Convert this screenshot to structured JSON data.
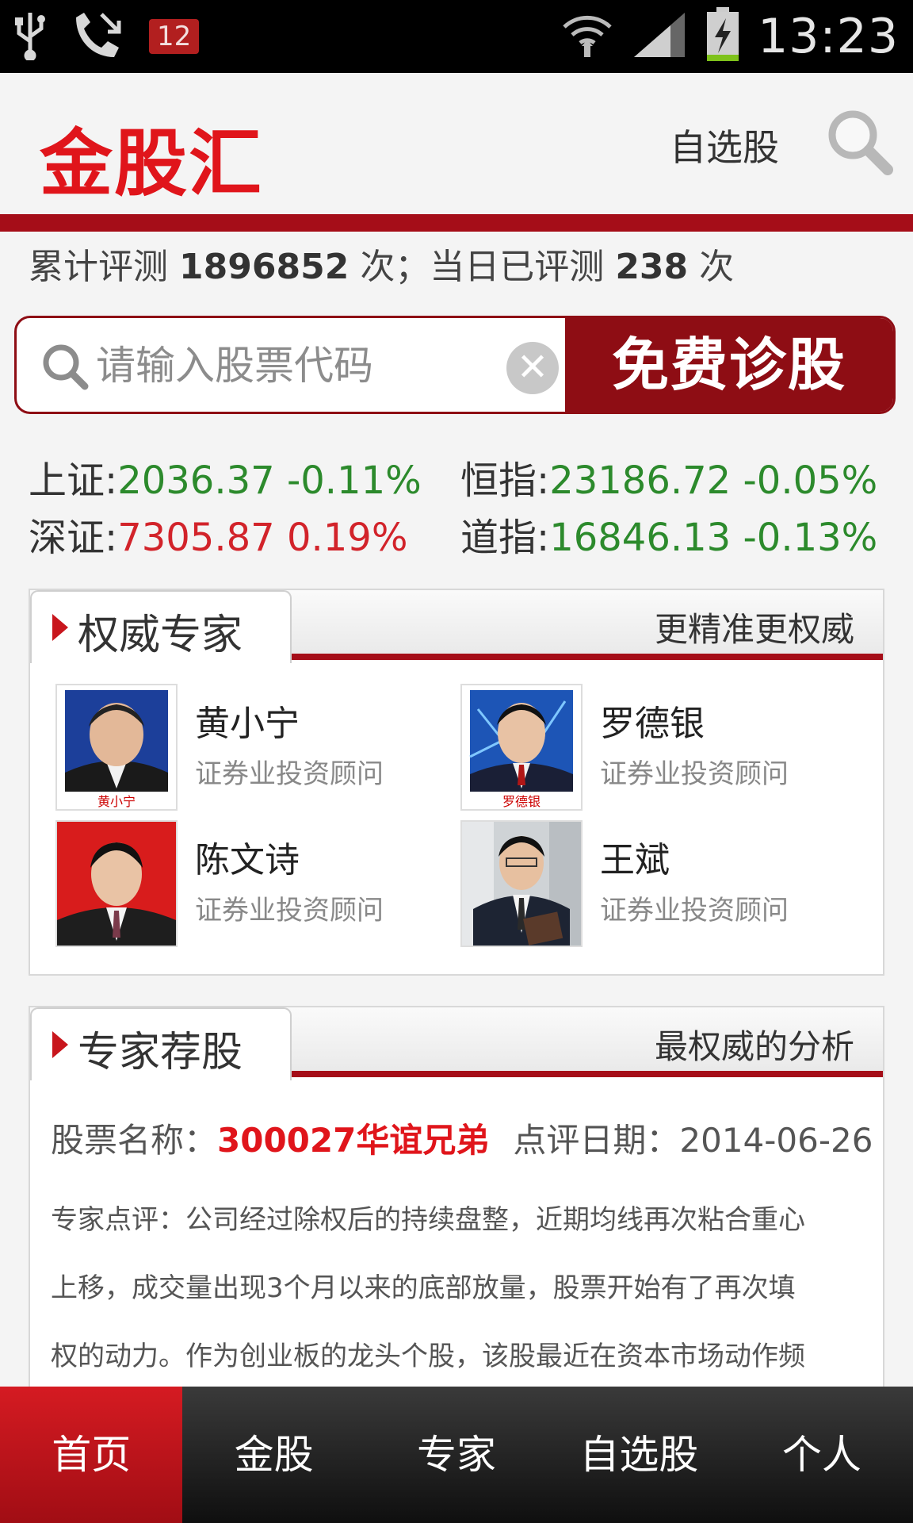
{
  "status_bar": {
    "notification_count": "12",
    "time": "13:23"
  },
  "header": {
    "logo": "金股汇",
    "watchlist_label": "自选股"
  },
  "stats": {
    "prefix": "累计评测",
    "total": "1896852",
    "mid": "次；当日已评测",
    "today": "238",
    "suffix": "次"
  },
  "search": {
    "placeholder": "请输入股票代码",
    "button_label": "免费诊股"
  },
  "indices": [
    {
      "name": "上证:",
      "value": "2036.37 -0.11%",
      "trend": "down"
    },
    {
      "name": "恒指:",
      "value": "23186.72 -0.05%",
      "trend": "down"
    },
    {
      "name": "深证:",
      "value": "7305.87 0.19%",
      "trend": "up"
    },
    {
      "name": "道指:",
      "value": "16846.13 -0.13%",
      "trend": "down"
    }
  ],
  "experts_panel": {
    "title": "权威专家",
    "subtitle": "更精准更权威",
    "experts": [
      {
        "name": "黄小宁",
        "title": "证券业投资顾问",
        "photo_caption": "黄小宁"
      },
      {
        "name": "罗德银",
        "title": "证券业投资顾问",
        "photo_caption": "罗德银"
      },
      {
        "name": "陈文诗",
        "title": "证券业投资顾问"
      },
      {
        "name": "王斌",
        "title": "证券业投资顾问"
      }
    ]
  },
  "picks_panel": {
    "title": "专家荐股",
    "subtitle": "最权威的分析",
    "stock_label": "股票名称：",
    "stock_name": "300027华谊兄弟",
    "date_label": "点评日期：",
    "date": "2014-06-26",
    "review_lines": [
      "专家点评：公司经过除权后的持续盘整，近期均线再次粘合重心",
      "上移，成交量出现3个月以来的底部放量，股票开始有了再次填",
      "权的动力。作为创业板的龙头个股，该股最近在资本市场动作频"
    ]
  },
  "bottom_nav": {
    "items": [
      "首页",
      "金股",
      "专家",
      "自选股",
      "个人"
    ],
    "active_index": 0
  },
  "colors": {
    "brand_red": "#e0151b",
    "dark_red": "#8e0d14",
    "up_red": "#d2232a",
    "down_green": "#2c8a2c"
  }
}
